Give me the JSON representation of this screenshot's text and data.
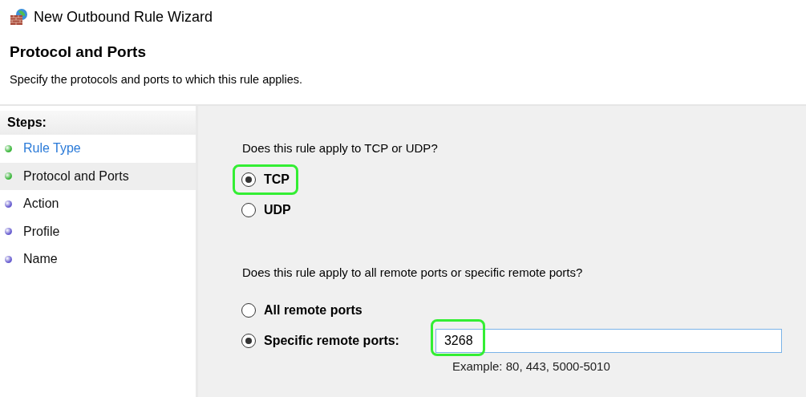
{
  "window": {
    "title": "New Outbound Rule Wizard"
  },
  "header": {
    "heading": "Protocol and Ports",
    "description": "Specify the protocols and ports to which this rule applies."
  },
  "steps": {
    "title": "Steps:",
    "items": [
      {
        "label": "Rule Type",
        "kind": "done",
        "selected": false,
        "link": true
      },
      {
        "label": "Protocol and Ports",
        "kind": "done",
        "selected": true,
        "link": false
      },
      {
        "label": "Action",
        "kind": "pending",
        "selected": false,
        "link": false
      },
      {
        "label": "Profile",
        "kind": "pending",
        "selected": false,
        "link": false
      },
      {
        "label": "Name",
        "kind": "pending",
        "selected": false,
        "link": false
      }
    ]
  },
  "protocol": {
    "question": "Does this rule apply to TCP or UDP?",
    "options": [
      {
        "label": "TCP",
        "selected": true,
        "highlighted": true
      },
      {
        "label": "UDP",
        "selected": false,
        "highlighted": false
      }
    ]
  },
  "ports": {
    "question": "Does this rule apply to all remote ports or specific remote ports?",
    "options": [
      {
        "label": "All remote ports",
        "selected": false
      },
      {
        "label": "Specific remote ports:",
        "selected": true
      }
    ],
    "field": {
      "value": "3268",
      "highlighted": true
    },
    "example": "Example: 80, 443, 5000-5010"
  }
}
